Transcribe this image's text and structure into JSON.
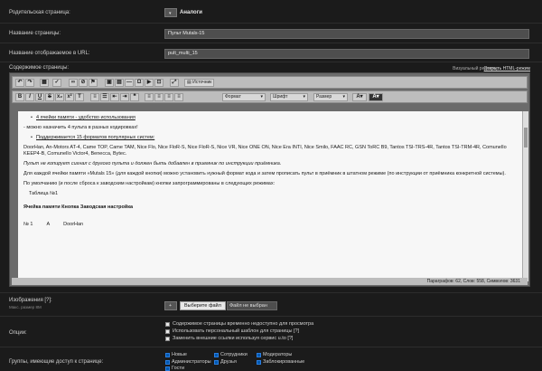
{
  "form": {
    "parent_page": {
      "label": "Родительская страница:",
      "value": "Аналоги"
    },
    "page_name": {
      "label": "Название страницы:",
      "value": "Пульт Mutals-15"
    },
    "url_name": {
      "label": "Название отображаемое в URL:",
      "value": "pult_multi_15"
    },
    "content": {
      "label": "Содержимое страницы:",
      "visual_editor_label": "Визуальный редактор",
      "open_html_link": "Открыть HTML-режим"
    },
    "images": {
      "label": "Изображения [?]:",
      "hint": "Макс. размер 8M",
      "small_button": "",
      "choose_file_button": "Выберите файл",
      "no_file_text": "Файл не выбран"
    },
    "options": {
      "label": "Опции:",
      "items": [
        {
          "label": "Содержимое страницы временно недоступно для просмотра",
          "checked": false
        },
        {
          "label": "Использовать персональный шаблон для страницы [?]",
          "checked": false
        },
        {
          "label": "Заменить внешние ссылки используя сервис u.to [?]",
          "checked": false
        }
      ]
    },
    "groups": {
      "label": "Группы, имеющие доступ к странице:",
      "items": [
        {
          "label": "Новые",
          "checked": true
        },
        {
          "label": "Сотрудники",
          "checked": true
        },
        {
          "label": "Модераторы",
          "checked": true
        },
        {
          "label": "Администраторы",
          "checked": true
        },
        {
          "label": "Друзья",
          "checked": true
        },
        {
          "label": "Заблокированные",
          "checked": true
        },
        {
          "label": "Гости",
          "checked": true
        }
      ]
    }
  },
  "editor": {
    "source_button": "Источник",
    "format_select": "Формат",
    "font_select": "Шрифт",
    "size_select": "Размер",
    "status": "Параграфов: 62, Слов: 558, Символов: 3631",
    "content": {
      "li1": "4 ячейки памяти - удобство использования",
      "p1": "- можно назначить 4 пульта в разных кодировках!",
      "li2": "Поддерживается 15 форматов популярных систем:",
      "p2": "DoorHan, An-Motors AT-4, Came TOP, Came TAM, Nice Flo, Nice FloR-S, Nice FloR-S, Nice VR, Nice ONE ON, Nice Era INTI, Nice Smilo, FAAC RC, GSN ToRC B9, Tantos TSI-TRS-4R, Tantos TSI-TRM-4R, ComunelIo KEEP4-B, ComunelIo Victor4, Benecca, Bytec.",
      "p3": "Пульт не копирует сигнал с другого пульта и должен быть добавлен в приемник по инструкции приёмника.",
      "p4": "Для каждой ячейки памяти «Mutals 15» (для каждой кнопки) можно установить нужный формат кода и затем прописать пульт в приёмник в штатном режиме (по инструкции от приёмника конкретной системы).",
      "p5": "По умолчанию (и после сброса к заводским настройкам) кнопки запрограммированы в следующих режимах:",
      "table_title": "Таблица №1",
      "table_header": "Ячейка памяти Кнопка Заводская настройка",
      "row1": "№ 1          A          DoorHan"
    }
  }
}
